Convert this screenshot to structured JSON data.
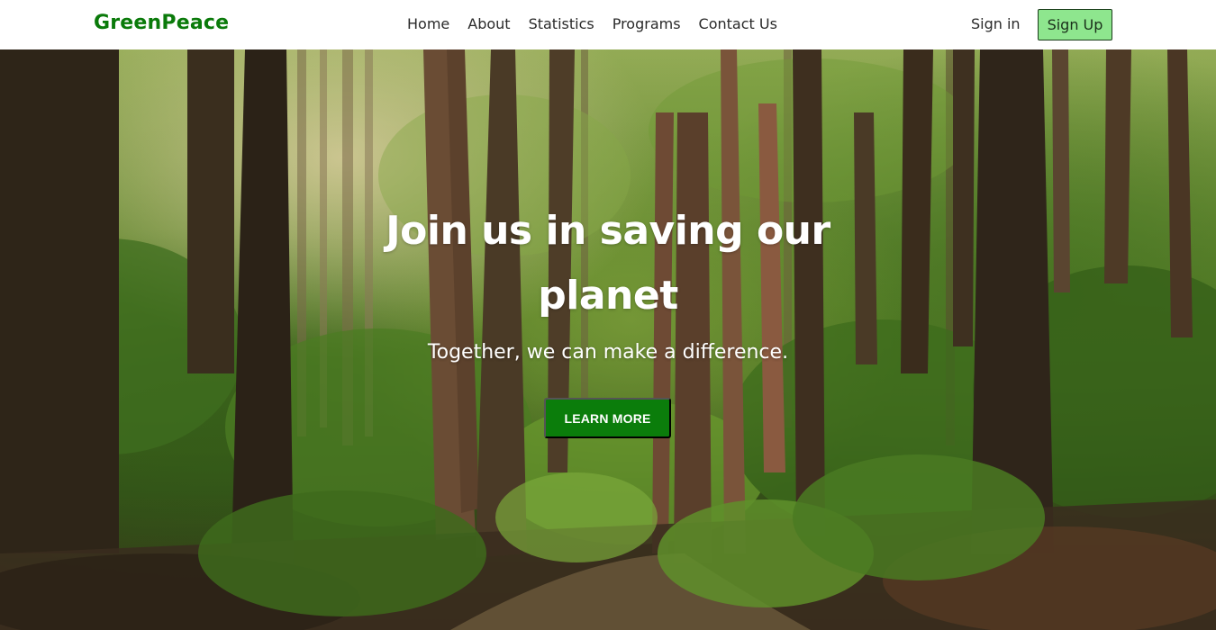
{
  "nav": {
    "brand": "GreenPeace",
    "links": [
      {
        "label": "Home"
      },
      {
        "label": "About"
      },
      {
        "label": "Statistics"
      },
      {
        "label": "Programs"
      },
      {
        "label": "Contact Us"
      }
    ],
    "signin_label": "Sign in",
    "signup_label": "Sign Up"
  },
  "hero": {
    "title": "Join us in saving our planet",
    "subtitle": "Together, we can make a difference.",
    "cta_label": "LEARN MORE"
  },
  "colors": {
    "brand": "#0a7a0a",
    "signup_bg": "#8ee68e",
    "cta_bg": "#0b7d0b"
  }
}
